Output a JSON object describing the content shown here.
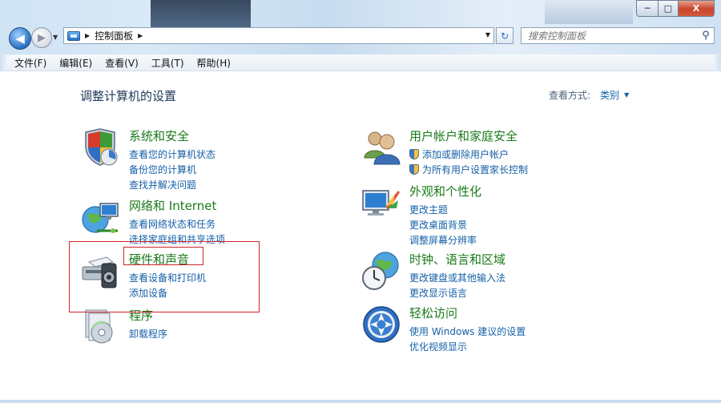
{
  "window": {
    "caption_buttons": {
      "minimize": "─",
      "maximize": "□",
      "close": "X"
    }
  },
  "nav": {
    "back_glyph": "◀",
    "forward_glyph": "▶",
    "history_glyph": "▼"
  },
  "address": {
    "crumb": "控制面板",
    "separator": "▶",
    "dropdown_glyph": "▼",
    "refresh_glyph": "↻"
  },
  "search": {
    "placeholder": "搜索控制面板",
    "icon_glyph": "⚲"
  },
  "menu": [
    "文件(F)",
    "编辑(E)",
    "查看(V)",
    "工具(T)",
    "帮助(H)"
  ],
  "page": {
    "title": "调整计算机的设置",
    "view_by_label": "查看方式:",
    "view_by_value": "类别",
    "view_caret": "▼"
  },
  "categories": [
    {
      "title": "系统和安全",
      "links": [
        "查看您的计算机状态",
        "备份您的计算机",
        "查找并解决问题"
      ],
      "icon": "shield-icon"
    },
    {
      "title": "网络和 Internet",
      "links": [
        "查看网络状态和任务",
        "选择家庭组和共享选项"
      ],
      "icon": "network-icon"
    },
    {
      "title": "硬件和声音",
      "links": [
        "查看设备和打印机",
        "添加设备"
      ],
      "icon": "hardware-sound-icon"
    },
    {
      "title": "程序",
      "links": [
        "卸载程序"
      ],
      "icon": "programs-icon"
    },
    {
      "title": "用户帐户和家庭安全",
      "links": [
        "添加或删除用户帐户",
        "为所有用户设置家长控制"
      ],
      "icon": "users-icon",
      "shielded_links": true
    },
    {
      "title": "外观和个性化",
      "links": [
        "更改主题",
        "更改桌面背景",
        "调整屏幕分辨率"
      ],
      "icon": "appearance-icon"
    },
    {
      "title": "时钟、语言和区域",
      "links": [
        "更改键盘或其他输入法",
        "更改显示语言"
      ],
      "icon": "clock-globe-icon"
    },
    {
      "title": "轻松访问",
      "links": [
        "使用 Windows 建议的设置",
        "优化视频显示"
      ],
      "icon": "ease-of-access-icon"
    }
  ],
  "colors": {
    "category_title": "#1a7a1a",
    "link": "#1560a8",
    "page_title": "#1e395b",
    "highlight": "#d0242b"
  }
}
